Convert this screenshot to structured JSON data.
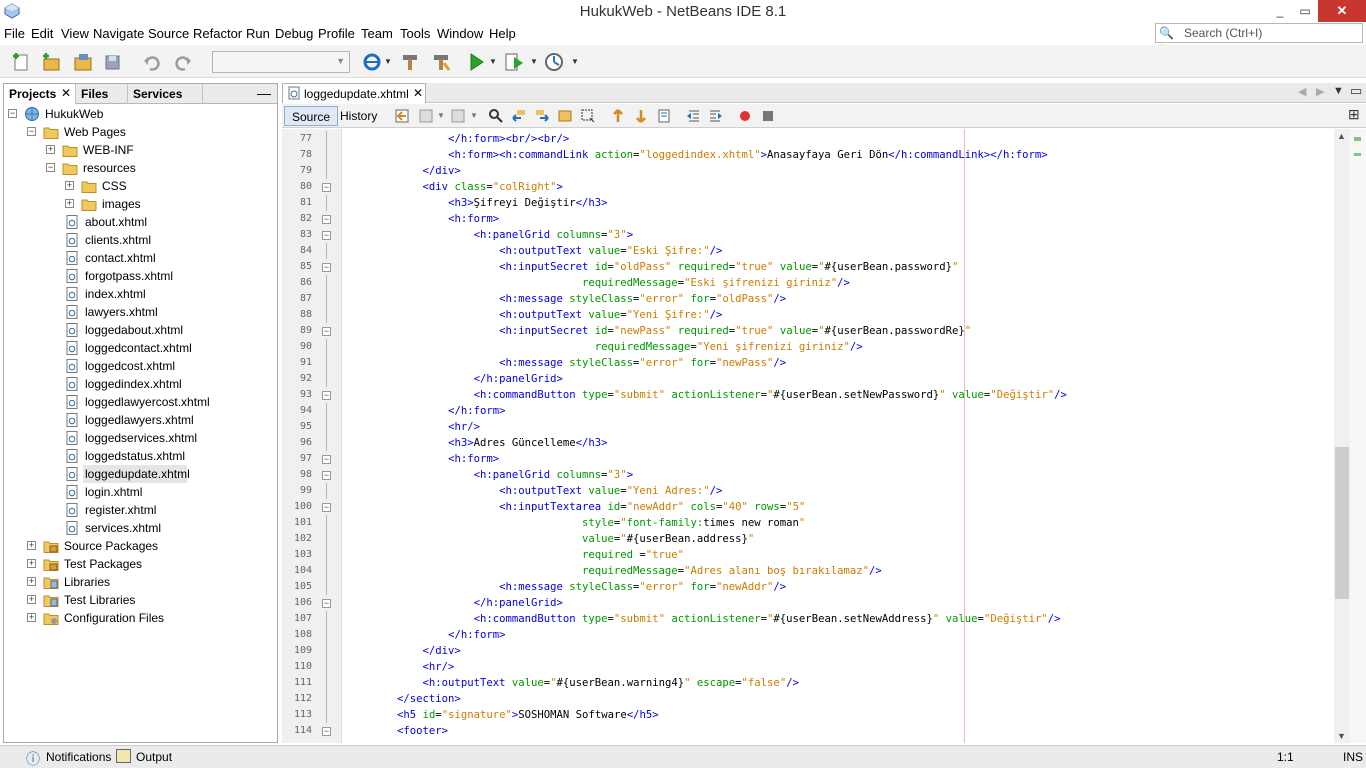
{
  "window": {
    "title": "HukukWeb - NetBeans IDE 8.1",
    "min": "_",
    "max": "▭",
    "close": "✕"
  },
  "menu": [
    "File",
    "Edit",
    "View",
    "Navigate",
    "Source",
    "Refactor",
    "Run",
    "Debug",
    "Profile",
    "Team",
    "Tools",
    "Window",
    "Help"
  ],
  "search": {
    "placeholder": "Search (Ctrl+I)"
  },
  "left_panel": {
    "tabs": [
      "Projects",
      "Files",
      "Services"
    ],
    "minimize": "—",
    "tree": [
      {
        "label": "HukukWeb"
      },
      {
        "label": "Web Pages"
      },
      {
        "label": "WEB-INF"
      },
      {
        "label": "resources"
      },
      {
        "label": "CSS"
      },
      {
        "label": "images"
      },
      {
        "label": "about.xhtml"
      },
      {
        "label": "clients.xhtml"
      },
      {
        "label": "contact.xhtml"
      },
      {
        "label": "forgotpass.xhtml"
      },
      {
        "label": "index.xhtml"
      },
      {
        "label": "lawyers.xhtml"
      },
      {
        "label": "loggedabout.xhtml"
      },
      {
        "label": "loggedcontact.xhtml"
      },
      {
        "label": "loggedcost.xhtml"
      },
      {
        "label": "loggedindex.xhtml"
      },
      {
        "label": "loggedlawyercost.xhtml"
      },
      {
        "label": "loggedlawyers.xhtml"
      },
      {
        "label": "loggedservices.xhtml"
      },
      {
        "label": "loggedstatus.xhtml"
      },
      {
        "label": "loggedupdate.xhtml"
      },
      {
        "label": "login.xhtml"
      },
      {
        "label": "register.xhtml"
      },
      {
        "label": "services.xhtml"
      },
      {
        "label": "Source Packages"
      },
      {
        "label": "Test Packages"
      },
      {
        "label": "Libraries"
      },
      {
        "label": "Test Libraries"
      },
      {
        "label": "Configuration Files"
      }
    ]
  },
  "editor": {
    "file_tab": "loggedupdate.xhtml",
    "view_tabs": [
      "Source",
      "History"
    ],
    "line_numbers": [
      "77",
      "78",
      "79",
      "80",
      "81",
      "82",
      "83",
      "84",
      "85",
      "86",
      "87",
      "88",
      "89",
      "90",
      "91",
      "92",
      "93",
      "94",
      "95",
      "96",
      "97",
      "98",
      "99",
      "100",
      "101",
      "102",
      "103",
      "104",
      "105",
      "106",
      "107",
      "108",
      "109",
      "110",
      "111",
      "112",
      "113",
      "114"
    ],
    "lines": [
      "                <span class=\"tg\">&lt;/h:form&gt;&lt;br/&gt;&lt;br/&gt;</span>",
      "                <span class=\"tg\">&lt;h:form&gt;&lt;h:commandLink</span> <span class=\"at\">action</span>=<span class=\"sv\">\"loggedindex.xhtml\"</span><span class=\"tg\">&gt;</span>Anasayfaya Geri Dön<span class=\"tg\">&lt;/h:commandLink&gt;&lt;/h:form&gt;</span>",
      "            <span class=\"tg\">&lt;/div&gt;</span>",
      "            <span class=\"tg\">&lt;div</span> <span class=\"at\">class</span>=<span class=\"sv\">\"colRight\"</span><span class=\"tg\">&gt;</span>",
      "                <span class=\"tg\">&lt;h3&gt;</span>Şifreyi Değiştir<span class=\"tg\">&lt;/h3&gt;</span>",
      "                <span class=\"tg\">&lt;h:form&gt;</span>",
      "                    <span class=\"tg\">&lt;h:panelGrid</span> <span class=\"at\">columns</span>=<span class=\"sv\">\"3\"</span><span class=\"tg\">&gt;</span>",
      "                        <span class=\"tg\">&lt;h:outputText</span> <span class=\"at\">value</span>=<span class=\"sv\">\"Eski Şifre:\"</span><span class=\"tg\">/&gt;</span>",
      "                        <span class=\"tg\">&lt;h:inputSecret</span> <span class=\"at\">id</span>=<span class=\"sv\">\"oldPass\"</span> <span class=\"at\">required</span>=<span class=\"sv\">\"true\"</span> <span class=\"at\">value</span>=<span class=\"sv\">\"</span>#{userBean.password}<span class=\"sv\">\"</span>",
      "                                     <span class=\"at\">requiredMessage</span>=<span class=\"sv\">\"Eski şifrenizi giriniz\"</span><span class=\"tg\">/&gt;</span>",
      "                        <span class=\"tg\">&lt;h:message</span> <span class=\"at\">styleClass</span>=<span class=\"sv\">\"error\"</span> <span class=\"at\">for</span>=<span class=\"sv\">\"oldPass\"</span><span class=\"tg\">/&gt;</span>",
      "                        <span class=\"tg\">&lt;h:outputText</span> <span class=\"at\">value</span>=<span class=\"sv\">\"Yeni Şifre:\"</span><span class=\"tg\">/&gt;</span>",
      "                        <span class=\"tg\">&lt;h:inputSecret</span> <span class=\"at\">id</span>=<span class=\"sv\">\"newPass\"</span> <span class=\"at\">required</span>=<span class=\"sv\">\"true\"</span> <span class=\"at\">value</span>=<span class=\"sv\">\"</span>#{userBean.passwordRe}<span class=\"sv\">\"</span>",
      "                                       <span class=\"at\">requiredMessage</span>=<span class=\"sv\">\"Yeni şifrenizi giriniz\"</span><span class=\"tg\">/&gt;</span>",
      "                        <span class=\"tg\">&lt;h:message</span> <span class=\"at\">styleClass</span>=<span class=\"sv\">\"error\"</span> <span class=\"at\">for</span>=<span class=\"sv\">\"newPass\"</span><span class=\"tg\">/&gt;</span>",
      "                    <span class=\"tg\">&lt;/h:panelGrid&gt;</span>",
      "                    <span class=\"tg\">&lt;h:commandButton</span> <span class=\"at\">type</span>=<span class=\"sv\">\"submit\"</span> <span class=\"at\">actionListener</span>=<span class=\"sv\">\"</span>#{userBean.setNewPassword}<span class=\"sv\">\"</span> <span class=\"at\">value</span>=<span class=\"sv\">\"Değiştir\"</span><span class=\"tg\">/&gt;</span>",
      "                <span class=\"tg\">&lt;/h:form&gt;</span>",
      "                <span class=\"tg\">&lt;hr/&gt;</span>",
      "                <span class=\"tg\">&lt;h3&gt;</span>Adres Güncelleme<span class=\"tg\">&lt;/h3&gt;</span>",
      "                <span class=\"tg\">&lt;h:form&gt;</span>",
      "                    <span class=\"tg\">&lt;h:panelGrid</span> <span class=\"at\">columns</span>=<span class=\"sv\">\"3\"</span><span class=\"tg\">&gt;</span>",
      "                        <span class=\"tg\">&lt;h:outputText</span> <span class=\"at\">value</span>=<span class=\"sv\">\"Yeni Adres:\"</span><span class=\"tg\">/&gt;</span>",
      "                        <span class=\"tg\">&lt;h:inputTextarea</span> <span class=\"at\">id</span>=<span class=\"sv\">\"newAddr\"</span> <span class=\"at\">cols</span>=<span class=\"sv\">\"40\"</span> <span class=\"at\">rows</span>=<span class=\"sv\">\"5\"</span>",
      "                                     <span class=\"at\">style</span>=<span class=\"sv\">\"</span><span class=\"at\">font-family:</span>times new roman<span class=\"sv\">\"</span>",
      "                                     <span class=\"at\">value</span>=<span class=\"sv\">\"</span>#{userBean.address}<span class=\"sv\">\"</span>",
      "                                     <span class=\"at\">required</span> =<span class=\"sv\">\"true\"</span>",
      "                                     <span class=\"at\">requiredMessage</span>=<span class=\"sv\">\"Adres alanı boş bırakılamaz\"</span><span class=\"tg\">/&gt;</span>",
      "                        <span class=\"tg\">&lt;h:message</span> <span class=\"at\">styleClass</span>=<span class=\"sv\">\"error\"</span> <span class=\"at\">for</span>=<span class=\"sv\">\"newAddr\"</span><span class=\"tg\">/&gt;</span>",
      "                    <span class=\"tg\">&lt;/h:panelGrid&gt;</span>",
      "                    <span class=\"tg\">&lt;h:commandButton</span> <span class=\"at\">type</span>=<span class=\"sv\">\"submit\"</span> <span class=\"at\">actionListener</span>=<span class=\"sv\">\"</span>#{userBean.setNewAddress}<span class=\"sv\">\"</span> <span class=\"at\">value</span>=<span class=\"sv\">\"Değiştir\"</span><span class=\"tg\">/&gt;</span>",
      "                <span class=\"tg\">&lt;/h:form&gt;</span>",
      "            <span class=\"tg\">&lt;/div&gt;</span>",
      "            <span class=\"tg\">&lt;hr/&gt;</span>",
      "            <span class=\"tg\">&lt;h:outputText</span> <span class=\"at\">value</span>=<span class=\"sv\">\"</span>#{userBean.warning4}<span class=\"sv\">\"</span> <span class=\"at\">escape</span>=<span class=\"sv\">\"false\"</span><span class=\"tg\">/&gt;</span>",
      "        <span class=\"tg\">&lt;/section&gt;</span>",
      "        <span class=\"tg\">&lt;h5</span> <span class=\"at\">id</span>=<span class=\"sv\">\"signature\"</span><span class=\"tg\">&gt;</span>SOSHOMAN Software<span class=\"tg\">&lt;/h5&gt;</span>",
      "        <span class=\"tg\">&lt;footer&gt;</span>"
    ]
  },
  "statusbar": {
    "notifications": "Notifications",
    "output": "Output",
    "position": "1:1",
    "mode": "INS"
  },
  "colors": {
    "tag": "#0000e6",
    "attr": "#009900",
    "string": "#ce7b00",
    "close": "#c7372f"
  }
}
